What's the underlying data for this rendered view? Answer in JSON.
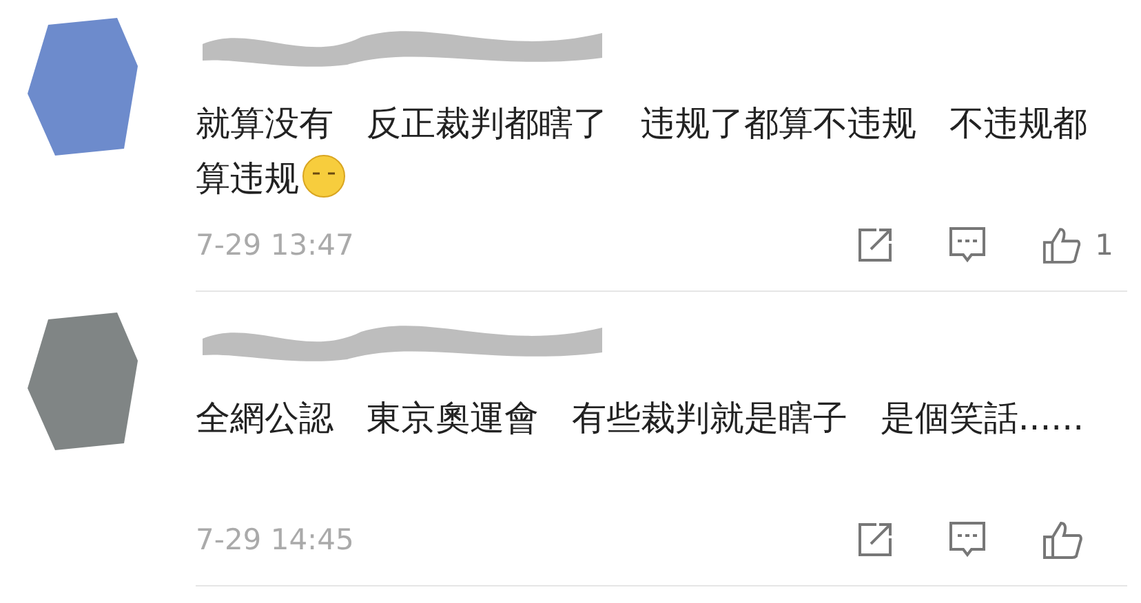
{
  "comments": [
    {
      "text": "就算没有 反正裁判都瞎了 违规了都算不违规 不违规都算违规",
      "emoji": true,
      "time": "7-29 13:47",
      "likes": "1"
    },
    {
      "text": "全網公認 東京奧運會 有些裁判就是瞎子 是個笑話......",
      "emoji": false,
      "time": "7-29 14:45"
    }
  ]
}
